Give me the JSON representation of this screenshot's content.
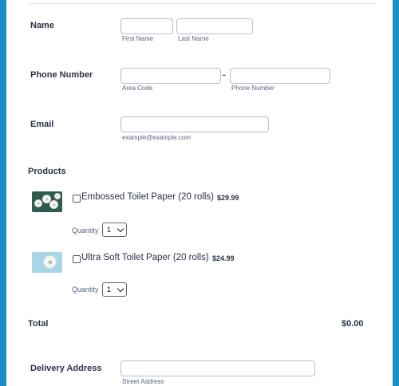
{
  "form": {
    "name": {
      "label": "Name",
      "first_sublabel": "First Name",
      "last_sublabel": "Last Name",
      "first_value": "",
      "last_value": ""
    },
    "phone": {
      "label": "Phone Number",
      "separator": "-",
      "area_sublabel": "Area Code",
      "number_sublabel": "Phone Number",
      "area_value": "",
      "number_value": ""
    },
    "email": {
      "label": "Email",
      "sublabel": "example@example.com",
      "value": ""
    },
    "products": {
      "title": "Products",
      "items": [
        {
          "name": "Embossed Toilet Paper (20 rolls)",
          "price": "$29.99",
          "quantity_label": "Quantity",
          "quantity": "1",
          "checked": false,
          "image_icon": "toilet-paper-rolls-dark"
        },
        {
          "name": "Ultra Soft Toilet Paper (20 rolls)",
          "price": "$24.99",
          "quantity_label": "Quantity",
          "quantity": "1",
          "checked": false,
          "image_icon": "toilet-paper-roll-light"
        }
      ]
    },
    "total": {
      "label": "Total",
      "value": "$0.00"
    },
    "delivery": {
      "label": "Delivery Address",
      "street_sublabel": "Street Address",
      "street_value": ""
    }
  },
  "colors": {
    "background": "#1a8fc4",
    "card": "#ffffff",
    "text": "#2c3345",
    "sublabel": "#57647e",
    "input_border": "#b8bdc9"
  }
}
